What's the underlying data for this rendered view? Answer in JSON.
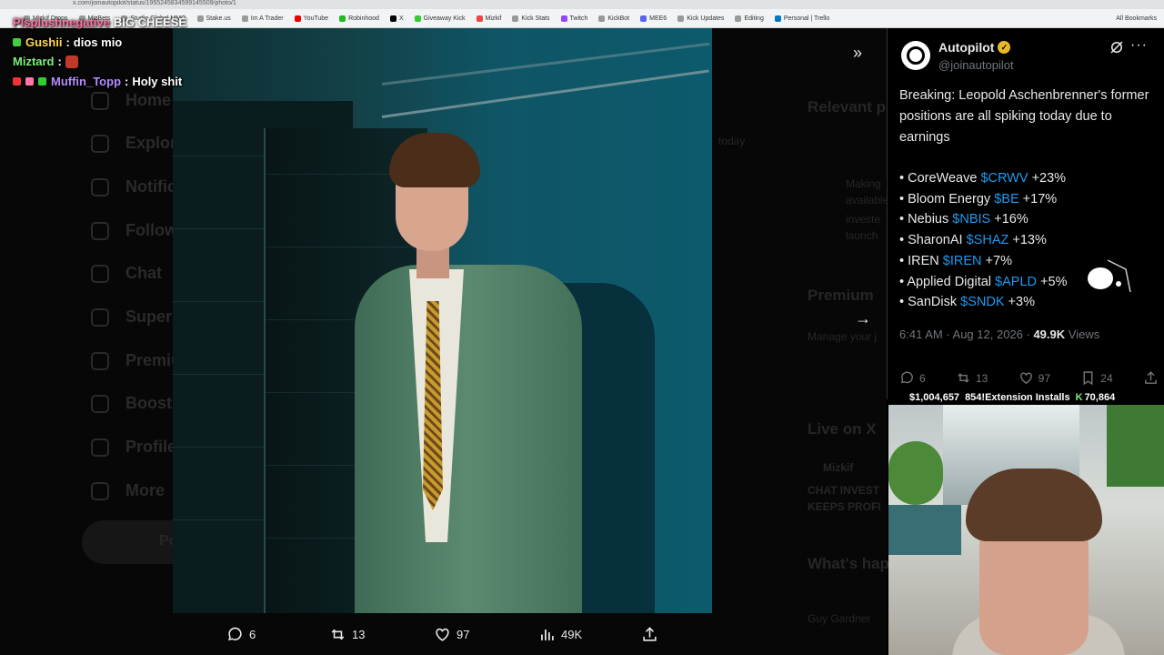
{
  "browser": {
    "url": "x.com/joinautopilot/status/1955245834599145509/photo/1",
    "bookmarks": [
      "Mizkif Drops",
      "MizBets",
      "Studio Global MMO",
      "Stake.us",
      "Im A Trader",
      "YouTube",
      "Robinhood",
      "X",
      "Giveaway Kick",
      "Mizkif",
      "Kick Stats",
      "Twitch",
      "KickBot",
      "MEE6",
      "Kick Updates",
      "Editing",
      "Personal | Trello"
    ],
    "all_bookmarks_label": "All Bookmarks"
  },
  "chat": [
    {
      "user": "Plsplushnegative",
      "message": "BIG CHEESE",
      "color": "#ff6fa0"
    },
    {
      "user": "Gushii",
      "message": "dios mio",
      "color": "#7df07d"
    },
    {
      "user": "Miztard",
      "message": "",
      "color": "#7df07d"
    },
    {
      "user": "Muffin_Topp",
      "message": "Holy shit",
      "color": "#69b7ff"
    }
  ],
  "background": {
    "nav": [
      "Home",
      "Explore",
      "Notifications",
      "Follow",
      "Chat",
      "Super",
      "Premium",
      "Boost",
      "Profile",
      "More"
    ],
    "post_button": "Post",
    "right_headings": [
      "Relevant people",
      "Premium",
      "Live on X",
      "What's happening"
    ],
    "right_small": [
      "Making",
      "available",
      "investe",
      "launch",
      "Manage your j",
      "Guy Gardner",
      "CHAT INVEST",
      "KEEPS PROFI",
      "Mizkif",
      "today"
    ]
  },
  "media_actions": {
    "replies": "6",
    "reposts": "13",
    "likes": "97",
    "views": "49K"
  },
  "tweet": {
    "author_name": "Autopilot",
    "handle": "@joinautopilot",
    "text": "Breaking: Leopold Aschenbrenner's former positions are all spiking today due to earnings",
    "bullets": [
      {
        "company": "CoreWeave",
        "ticker": "$CRWV",
        "change": "+23%"
      },
      {
        "company": "Bloom Energy",
        "ticker": "$BE",
        "change": "+17%"
      },
      {
        "company": "Nebius",
        "ticker": "$NBIS",
        "change": "+16%"
      },
      {
        "company": "SharonAI",
        "ticker": "$SHAZ",
        "change": "+13%"
      },
      {
        "company": "IREN",
        "ticker": "$IREN",
        "change": "+7%"
      },
      {
        "company": "Applied Digital",
        "ticker": "$APLD",
        "change": "+5%"
      },
      {
        "company": "SanDisk",
        "ticker": "$SNDK",
        "change": "+3%"
      }
    ],
    "time": "6:41 AM · Aug 12, 2026 · ",
    "views_count": "49.9K",
    "views_label": "Views",
    "replies": "6",
    "reposts": "13",
    "likes": "97",
    "bookmarks": "24"
  },
  "stream_stats": {
    "money": "$1,004,657",
    "installs": "854!Extension Installs",
    "k_count": "70,864"
  },
  "colors": {
    "accent": "#1d9bf0",
    "verified": "#e8b923",
    "muted": "#71767b"
  }
}
